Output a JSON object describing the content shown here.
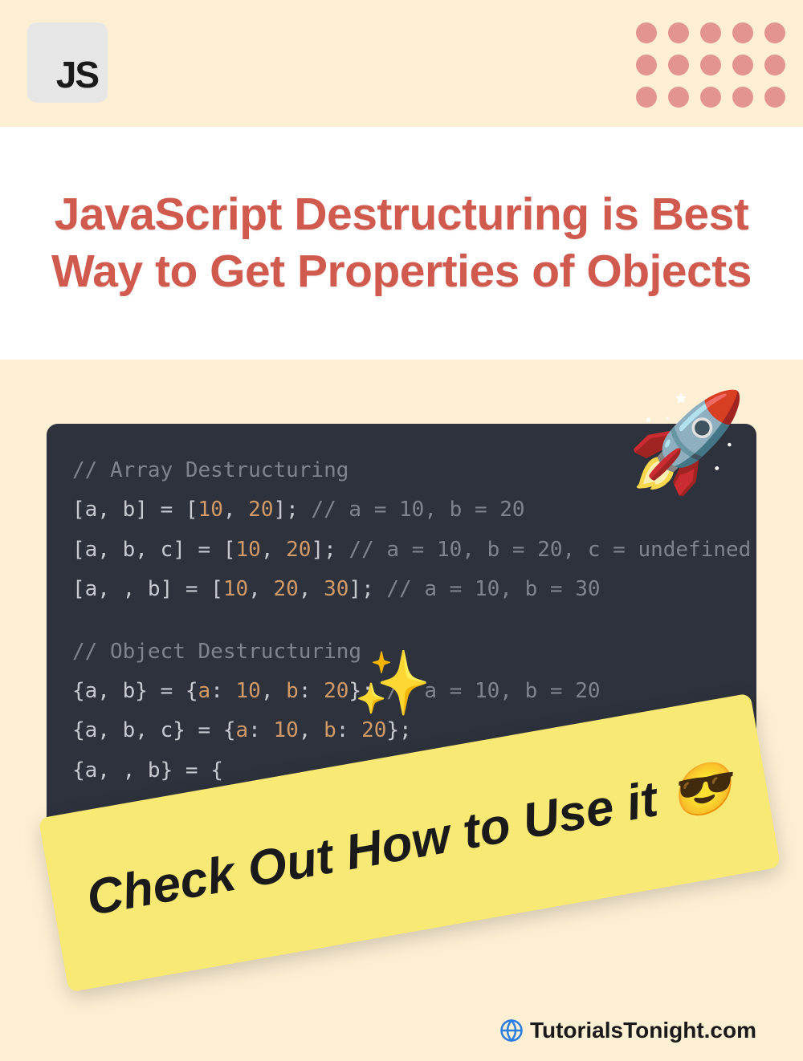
{
  "badge": {
    "label": "JS"
  },
  "title": "JavaScript Destructuring is Best Way to Get Properties of Objects",
  "icons": {
    "rocket": "🚀",
    "sparkles": "✨",
    "cool": "😎"
  },
  "code": {
    "section1_comment": "// Array Destructuring",
    "line1": {
      "lhs": "[a, b]",
      "rhs_open": "[",
      "rhs_vals": [
        "10",
        "20"
      ],
      "rhs_close": "];",
      "tail": " // a = 10, b = 20"
    },
    "line2": {
      "lhs": "[a, b, c]",
      "rhs_open": "[",
      "rhs_vals": [
        "10",
        "20"
      ],
      "rhs_close": "];",
      "tail": " // a = 10, b = 20, c = undefined"
    },
    "line3": {
      "lhs": "[a, , b]",
      "rhs_open": "[",
      "rhs_vals": [
        "10",
        "20",
        "30"
      ],
      "rhs_close": "];",
      "tail": " // a = 10, b = 30"
    },
    "section2_comment": "// Object Destructuring",
    "line4": {
      "lhs": "{a, b}",
      "rhs_open": "{",
      "pairs": [
        [
          "a",
          "10"
        ],
        [
          "b",
          "20"
        ]
      ],
      "rhs_close": "};",
      "tail": " // a = 10, b = 20"
    },
    "line5": {
      "lhs": "{a, b, c}",
      "rhs_open": "{",
      "pairs": [
        [
          "a",
          "10"
        ],
        [
          "b",
          "20"
        ]
      ],
      "rhs_close": "};",
      "tail": ""
    },
    "line6": {
      "lhs": "{a, , b}",
      "rhs_open": "{",
      "pairs": [],
      "rhs_close": "",
      "tail": ""
    }
  },
  "cta": {
    "text_prefix": "Check Out How to Use it "
  },
  "footer": {
    "site": "TutorialsTonight.com"
  }
}
